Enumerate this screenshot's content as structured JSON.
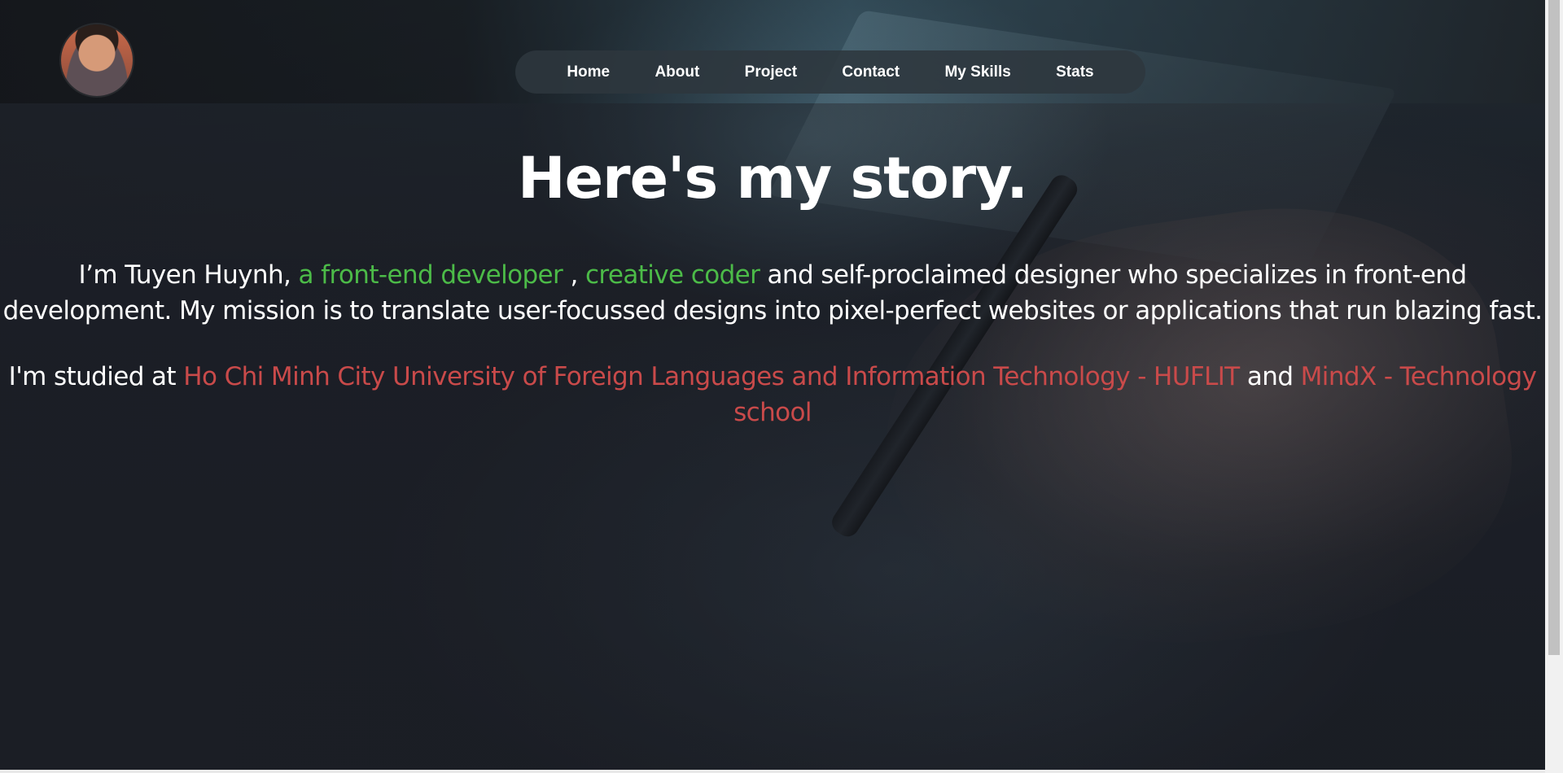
{
  "nav": {
    "items": [
      "Home",
      "About",
      "Project",
      "Contact",
      "My Skills",
      "Stats"
    ]
  },
  "main": {
    "title": "Here's my story.",
    "intro": {
      "lead": "I’m Tuyen Huynh, ",
      "role1": "a front-end developer ",
      "sep": ", ",
      "role2": "creative coder",
      "rest": " and self-proclaimed designer who specializes in front-end development. My mission is to translate user-focussed designs into pixel-perfect websites or applications that run blazing fast."
    },
    "education": {
      "lead": "I'm studied at ",
      "school1": "Ho Chi Minh City University of Foreign Languages and Information Technology - HUFLIT",
      "and": " and ",
      "school2": "MindX - Technology school"
    }
  },
  "colors": {
    "accent_green": "#4cbb48",
    "accent_red": "#c94a4a"
  }
}
